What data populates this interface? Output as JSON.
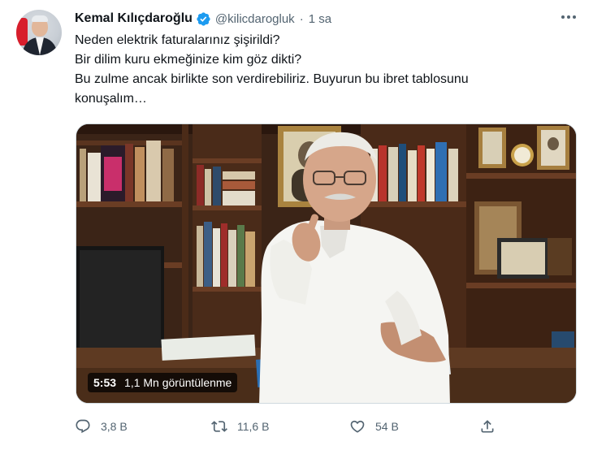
{
  "tweet": {
    "author": {
      "name": "Kemal Kılıçdaroğlu",
      "handle": "@kilicdarogluk",
      "verified_icon": "verified-badge-icon",
      "separator": "·",
      "time": "1 sa"
    },
    "menu_icon": "more-horizontal-icon",
    "text_lines": [
      "Neden elektrik faturalarınız şişirildi?",
      "Bir dilim kuru ekmeğinize kim göz dikti?",
      "Bu zulme ancak birlikte son verdirebiliriz. Buyurun bu ibret tablosunu",
      "konuşalım…"
    ],
    "video": {
      "duration": "5:53",
      "views": "1,1 Mn görüntülenme"
    },
    "actions": {
      "reply": {
        "icon": "reply-icon",
        "count": "3,8 B"
      },
      "retweet": {
        "icon": "retweet-icon",
        "count": "11,6 B"
      },
      "like": {
        "icon": "heart-icon",
        "count": "54 B"
      },
      "share": {
        "icon": "share-icon"
      }
    },
    "colors": {
      "verified": "#1d9bf0",
      "text": "#0f1419",
      "secondary": "#536471"
    }
  }
}
